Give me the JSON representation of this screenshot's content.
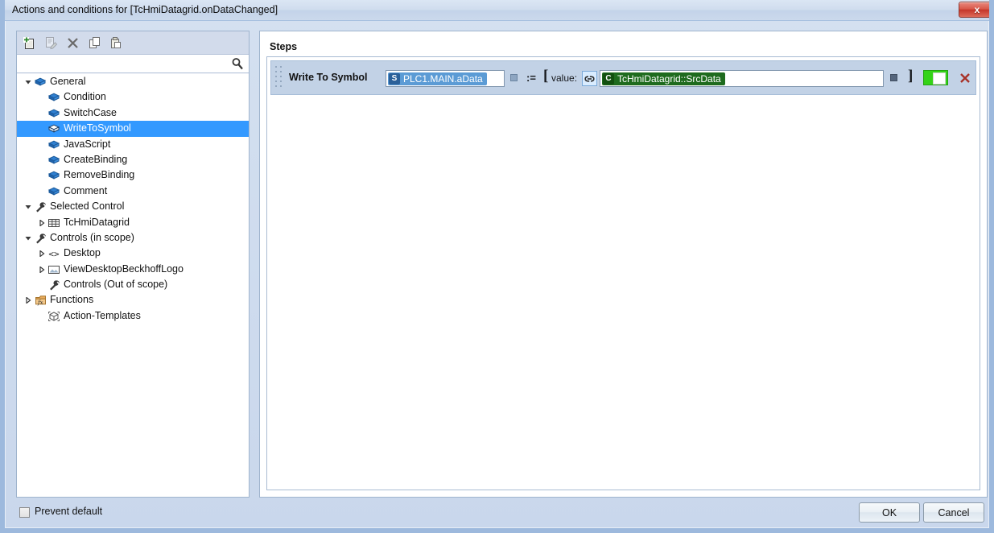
{
  "window": {
    "title": "Actions and conditions for [TcHmiDatagrid.onDataChanged]",
    "close_label": "x",
    "accent_selection": "#3399ff",
    "toggle_on_color": "#33d317"
  },
  "left_panel": {
    "toolbar": [
      {
        "name": "new-action-icon",
        "tooltip": "New",
        "enabled": true
      },
      {
        "name": "edit-action-icon",
        "tooltip": "Edit",
        "enabled": false
      },
      {
        "name": "delete-action-icon",
        "tooltip": "Delete",
        "enabled": true
      },
      {
        "name": "copy-action-icon",
        "tooltip": "Copy",
        "enabled": true
      },
      {
        "name": "paste-action-icon",
        "tooltip": "Paste",
        "enabled": true
      }
    ],
    "search": {
      "value": "",
      "placeholder": "",
      "icon": "search-icon"
    },
    "tree": [
      {
        "label": "General",
        "indent": 0,
        "arrow": "expanded",
        "icon": "action-cube-icon",
        "selected": false
      },
      {
        "label": "Condition",
        "indent": 1,
        "arrow": "none",
        "icon": "action-cube-icon",
        "selected": false
      },
      {
        "label": "SwitchCase",
        "indent": 1,
        "arrow": "none",
        "icon": "action-cube-icon",
        "selected": false
      },
      {
        "label": "WriteToSymbol",
        "indent": 1,
        "arrow": "none",
        "icon": "action-cube-icon",
        "selected": true
      },
      {
        "label": "JavaScript",
        "indent": 1,
        "arrow": "none",
        "icon": "action-cube-icon",
        "selected": false
      },
      {
        "label": "CreateBinding",
        "indent": 1,
        "arrow": "none",
        "icon": "action-cube-icon",
        "selected": false
      },
      {
        "label": "RemoveBinding",
        "indent": 1,
        "arrow": "none",
        "icon": "action-cube-icon",
        "selected": false
      },
      {
        "label": "Comment",
        "indent": 1,
        "arrow": "none",
        "icon": "action-cube-icon",
        "selected": false
      },
      {
        "label": "Selected Control",
        "indent": 0,
        "arrow": "expanded",
        "icon": "wrench-icon",
        "selected": false
      },
      {
        "label": "TcHmiDatagrid",
        "indent": 1,
        "arrow": "collapsed",
        "icon": "datagrid-icon",
        "selected": false
      },
      {
        "label": "Controls (in scope)",
        "indent": 0,
        "arrow": "expanded",
        "icon": "wrench-icon",
        "selected": false
      },
      {
        "label": "Desktop",
        "indent": 1,
        "arrow": "collapsed",
        "icon": "code-brackets-icon",
        "selected": false
      },
      {
        "label": "ViewDesktopBeckhoffLogo",
        "indent": 1,
        "arrow": "collapsed",
        "icon": "image-icon",
        "selected": false
      },
      {
        "label": "Controls (Out of scope)",
        "indent": 1,
        "arrow": "none",
        "icon": "wrench-icon",
        "selected": false
      },
      {
        "label": "Functions",
        "indent": 0,
        "arrow": "collapsed",
        "icon": "function-fx-icon",
        "selected": false
      },
      {
        "label": "Action-Templates",
        "indent": 1,
        "arrow": "none",
        "icon": "template-cube-icon",
        "selected": false
      }
    ]
  },
  "right_panel": {
    "heading": "Steps",
    "steps": [
      {
        "title": "Write To Symbol",
        "target": {
          "badge": "S",
          "text": "PLC1.MAIN.aData",
          "chip_color": "#5b9bd5"
        },
        "operator": ":=",
        "open_bracket": "[",
        "value_label": "value:",
        "link_icon": "link-icon",
        "value": {
          "badge": "C",
          "text": "TcHmiDatagrid::SrcData",
          "chip_color": "#1e6b1e"
        },
        "close_bracket": "]",
        "enabled_toggle": true,
        "delete_icon": "delete-x-icon"
      }
    ]
  },
  "footer": {
    "prevent_default": {
      "label": "Prevent default",
      "checked": false
    },
    "ok_label": "OK",
    "cancel_label": "Cancel"
  }
}
